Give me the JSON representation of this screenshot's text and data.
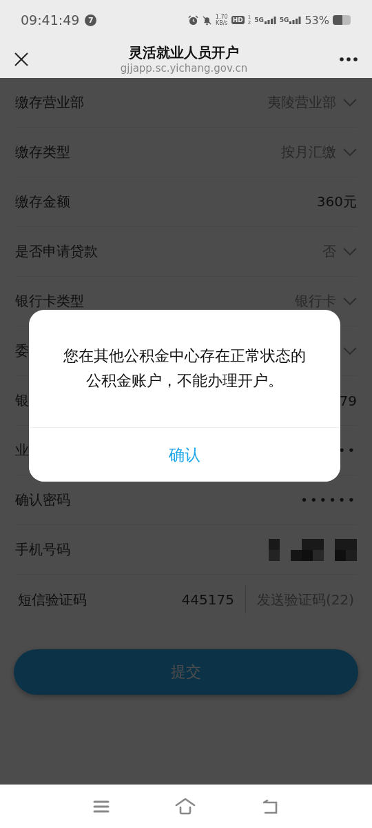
{
  "status_bar": {
    "time": "09:41:49",
    "notification_count": "7",
    "net_speed": "1.70",
    "net_speed_unit": "KB/s",
    "hd_badge": "HD",
    "sim_slots": [
      "1",
      "2"
    ],
    "networks": [
      "5G",
      "5G"
    ],
    "battery": "53%"
  },
  "header": {
    "title": "灵活就业人员开户",
    "url": "gjjapp.sc.yichang.gov.cn"
  },
  "form": {
    "rows": [
      {
        "kind": "select",
        "label": "缴存营业部",
        "value": "夷陵营业部"
      },
      {
        "kind": "select",
        "label": "缴存类型",
        "value": "按月汇缴"
      },
      {
        "kind": "text",
        "label": "缴存金额",
        "value": "360元"
      },
      {
        "kind": "select",
        "label": "是否申请贷款",
        "value": "否"
      },
      {
        "kind": "select",
        "label": "银行卡类型",
        "value": "银行卡"
      },
      {
        "kind": "select",
        "label": "委"
      },
      {
        "kind": "text",
        "label": "银",
        "value": "79"
      },
      {
        "kind": "password",
        "label": "业",
        "value": "••"
      },
      {
        "kind": "password",
        "label": "确认密码",
        "value": "••••••"
      },
      {
        "kind": "redacted",
        "label": "手机号码"
      },
      {
        "kind": "sms",
        "label": "短信验证码",
        "value": "445175",
        "action": "发送验证码(22)"
      }
    ]
  },
  "submit": "提交",
  "dialog": {
    "message": "您在其他公积金中心存在正常状态的公积金账户，不能办理开户。",
    "confirm": "确认"
  }
}
